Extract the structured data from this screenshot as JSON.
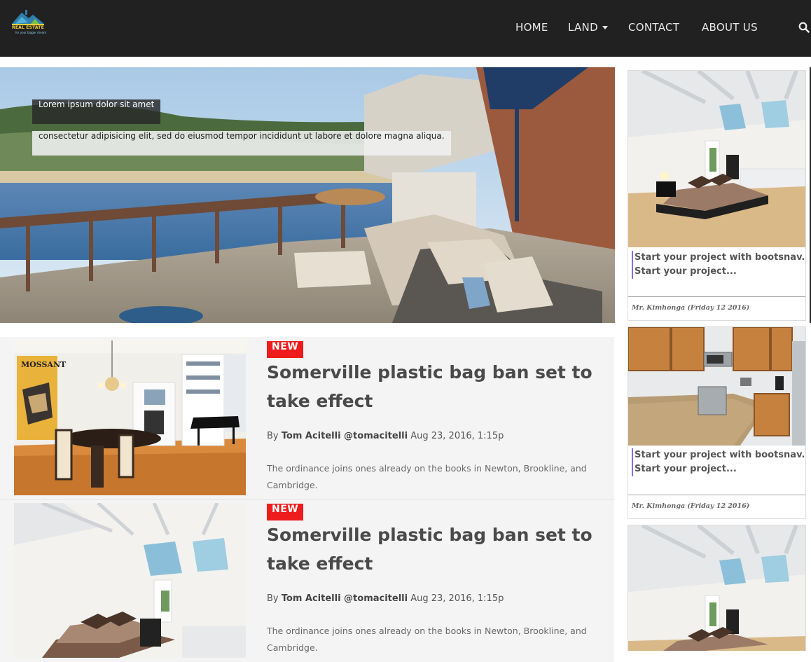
{
  "brand": {
    "logo_text": "REAL ESTATE",
    "logo_sub": "for your bigger dream"
  },
  "nav": {
    "items": [
      {
        "label": "HOME"
      },
      {
        "label": "LAND"
      },
      {
        "label": "CONTACT"
      },
      {
        "label": "ABOUT US"
      }
    ]
  },
  "hero": {
    "caption_title": "Lorem ipsum dolor sit amet",
    "caption_text": "consectetur adipisicing elit, sed do eiusmod tempor incididunt ut labore et dolore magna aliqua."
  },
  "articles": [
    {
      "badge": "NEW",
      "title": "Somerville plastic bag ban set to take effect",
      "by": "By",
      "author": "Tom Acitelli @tomacitelli",
      "date": "Aug 23, 2016, 1:15p",
      "excerpt": "The ordinance joins ones already on the books in Newton, Brookline, and Cambridge."
    },
    {
      "badge": "NEW",
      "title": "Somerville plastic bag ban set to take effect",
      "by": "By",
      "author": "Tom Acitelli @tomacitelli",
      "date": "Aug 23, 2016, 1:15p",
      "excerpt": "The ordinance joins ones already on the books in Newton, Brookline, and Cambridge."
    }
  ],
  "sidebar": {
    "cards": [
      {
        "text": "Start your project with bootsnav. Start your project...",
        "author": "Mr. Kimhonga (Friday 12 2016)"
      },
      {
        "text": "Start your project with bootsnav. Start your project...",
        "author": "Mr. Kimhonga (Friday 12 2016)"
      }
    ]
  },
  "colors": {
    "navbar": "#212121",
    "badge": "#ee1c1c",
    "title": "#4a4a4a",
    "article_bg": "#f4f4f4"
  }
}
